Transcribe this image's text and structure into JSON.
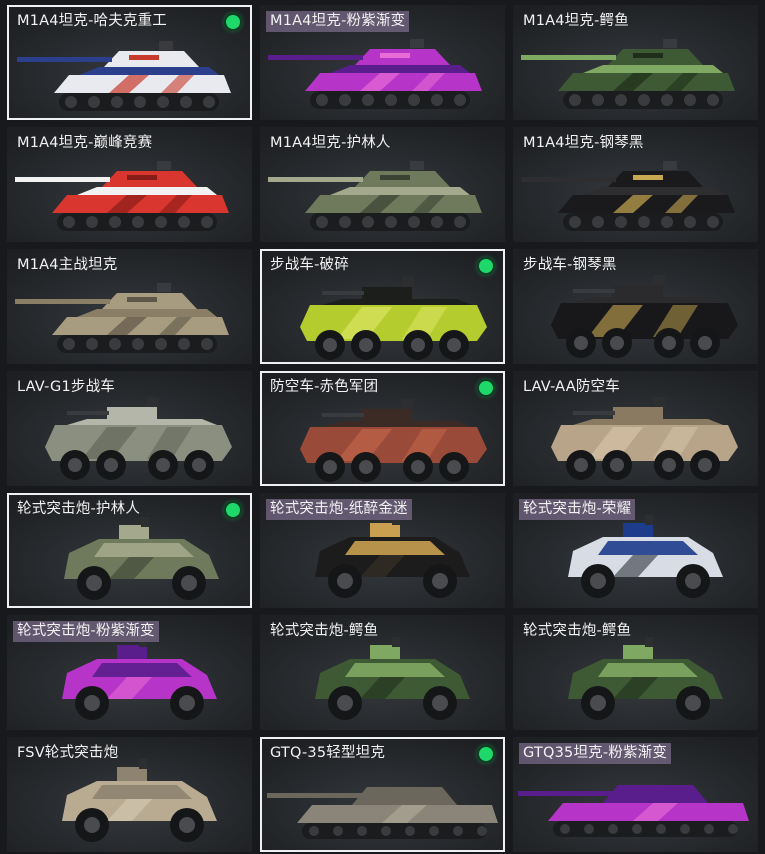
{
  "owned_marker_color": "#1ed96a",
  "vehicles": [
    {
      "name": "M1A4坦克-哈夫克重工",
      "kind": "tank",
      "colors": [
        "#e8eaf0",
        "#2c3f8c",
        "#c83a2c"
      ],
      "selected": true,
      "owned": true,
      "label_highlight": false
    },
    {
      "name": "M1A4坦克-粉紫渐变",
      "kind": "tank",
      "colors": [
        "#b634c8",
        "#5a1e8c",
        "#e86bd6"
      ],
      "selected": false,
      "owned": false,
      "label_highlight": true
    },
    {
      "name": "M1A4坦克-鳄鱼",
      "kind": "tank",
      "colors": [
        "#3e5a34",
        "#7fa862",
        "#1f2e1a"
      ],
      "selected": false,
      "owned": false,
      "label_highlight": false
    },
    {
      "name": "M1A4坦克-巅峰竞赛",
      "kind": "tank",
      "colors": [
        "#d8362e",
        "#f2f2f2",
        "#8a1c18"
      ],
      "selected": false,
      "owned": false,
      "label_highlight": false
    },
    {
      "name": "M1A4坦克-护林人",
      "kind": "tank",
      "colors": [
        "#6f7a5c",
        "#a4a88c",
        "#3b4233"
      ],
      "selected": false,
      "owned": false,
      "label_highlight": false
    },
    {
      "name": "M1A4坦克-钢琴黑",
      "kind": "tank",
      "colors": [
        "#1a1a1c",
        "#2e2e30",
        "#c8a850"
      ],
      "selected": false,
      "owned": false,
      "label_highlight": false
    },
    {
      "name": "M1A4主战坦克",
      "kind": "tank",
      "colors": [
        "#a89c80",
        "#8a7f66",
        "#5e5646"
      ],
      "selected": false,
      "owned": false,
      "label_highlight": false
    },
    {
      "name": "步战车-破碎",
      "kind": "ifv",
      "colors": [
        "#b5cc2e",
        "#1c1e1c",
        "#dfe86a"
      ],
      "selected": true,
      "owned": true,
      "label_highlight": false
    },
    {
      "name": "步战车-钢琴黑",
      "kind": "ifv",
      "colors": [
        "#18181a",
        "#2b2b2d",
        "#c8a850"
      ],
      "selected": false,
      "owned": false,
      "label_highlight": false
    },
    {
      "name": "LAV-G1步战车",
      "kind": "lav",
      "colors": [
        "#8a8f80",
        "#b4b6aa",
        "#5c6054"
      ],
      "selected": false,
      "owned": false,
      "label_highlight": false
    },
    {
      "name": "防空车-赤色军团",
      "kind": "lav",
      "colors": [
        "#9a4a38",
        "#3c2a24",
        "#c86a4c"
      ],
      "selected": true,
      "owned": true,
      "label_highlight": false
    },
    {
      "name": "LAV-AA防空车",
      "kind": "lav",
      "colors": [
        "#b8a488",
        "#8a7a62",
        "#d8c8ae"
      ],
      "selected": false,
      "owned": false,
      "label_highlight": false
    },
    {
      "name": "轮式突击炮-护林人",
      "kind": "armored",
      "colors": [
        "#6f7a5c",
        "#a4a88c",
        "#3b4233"
      ],
      "selected": true,
      "owned": true,
      "label_highlight": false
    },
    {
      "name": "轮式突击炮-纸醉金迷",
      "kind": "armored",
      "colors": [
        "#1c1c1c",
        "#c8a050",
        "#3a3226"
      ],
      "selected": false,
      "owned": false,
      "label_highlight": true
    },
    {
      "name": "轮式突击炮-荣耀",
      "kind": "armored",
      "colors": [
        "#d8dce4",
        "#1e3c8c",
        "#30343c"
      ],
      "selected": false,
      "owned": false,
      "label_highlight": true
    },
    {
      "name": "轮式突击炮-粉紫渐变",
      "kind": "armored",
      "colors": [
        "#b634c8",
        "#5a1e8c",
        "#e86bd6"
      ],
      "selected": false,
      "owned": false,
      "label_highlight": true
    },
    {
      "name": "轮式突击炮-鳄鱼",
      "kind": "armored",
      "colors": [
        "#3e5a34",
        "#7fa862",
        "#1f2e1a"
      ],
      "selected": false,
      "owned": false,
      "label_highlight": false
    },
    {
      "name": "轮式突击炮-鳄鱼",
      "kind": "armored",
      "colors": [
        "#3e5a34",
        "#7fa862",
        "#1f2e1a"
      ],
      "selected": false,
      "owned": false,
      "label_highlight": false
    },
    {
      "name": "FSV轮式突击炮",
      "kind": "armored",
      "colors": [
        "#b8ab92",
        "#8e8370",
        "#d6cbb4"
      ],
      "selected": false,
      "owned": false,
      "label_highlight": false
    },
    {
      "name": "GTQ-35轻型坦克",
      "kind": "light",
      "colors": [
        "#8a8578",
        "#6b675c",
        "#b0aa9a"
      ],
      "selected": true,
      "owned": true,
      "label_highlight": false
    },
    {
      "name": "GTQ35坦克-粉紫渐变",
      "kind": "light",
      "colors": [
        "#b634c8",
        "#5a1e8c",
        "#e86bd6"
      ],
      "selected": false,
      "owned": false,
      "label_highlight": true
    }
  ]
}
